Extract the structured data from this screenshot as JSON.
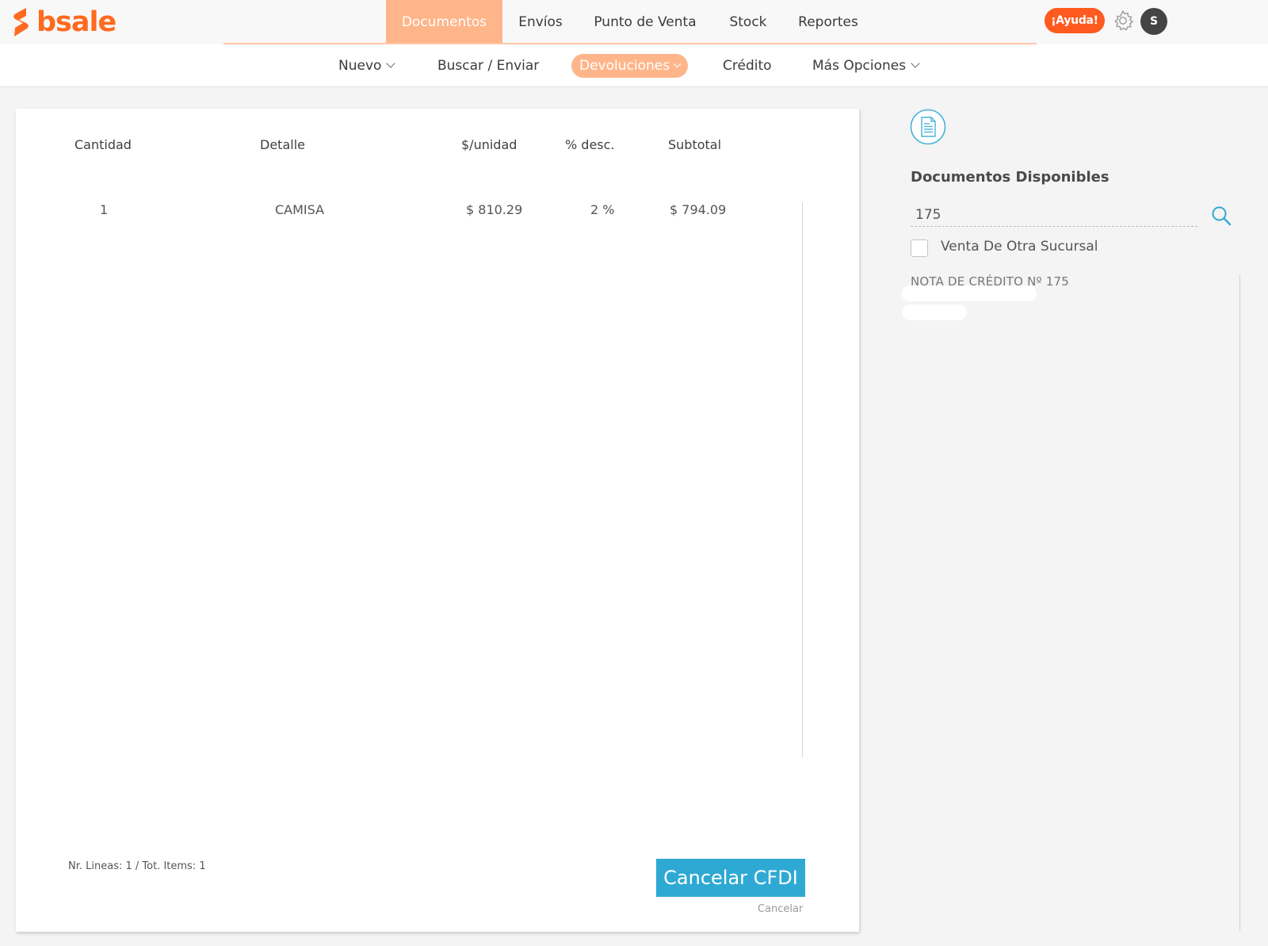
{
  "brand": {
    "logo_text": "bsale",
    "accent": "#ff6a1f"
  },
  "main_nav": {
    "items": [
      {
        "label": "Documentos",
        "active": true
      },
      {
        "label": "Envíos",
        "active": false
      },
      {
        "label": "Punto de Venta",
        "active": false
      },
      {
        "label": "Stock",
        "active": false
      },
      {
        "label": "Reportes",
        "active": false
      }
    ],
    "help_label": "¡Ayuda!",
    "avatar_initial": "S"
  },
  "sub_nav": {
    "items": [
      {
        "label": "Nuevo",
        "has_dropdown": true
      },
      {
        "label": "Buscar / Enviar",
        "has_dropdown": false
      },
      {
        "label": "Devoluciones",
        "has_dropdown": true,
        "active": true
      },
      {
        "label": "Crédito",
        "has_dropdown": false
      },
      {
        "label": "Más Opciones",
        "has_dropdown": true
      }
    ]
  },
  "document": {
    "columns": [
      "Cantidad",
      "Detalle",
      "$/unidad",
      "% desc.",
      "Subtotal"
    ],
    "rows": [
      {
        "cantidad": "1",
        "detalle": "CAMISA",
        "unit_price": "$ 810.29",
        "discount": "2 %",
        "subtotal": "$ 794.09"
      }
    ],
    "footer_count": "Nr. Lineas: 1 / Tot. Items: 1",
    "primary_button": "Cancelar CFDI",
    "cancel_link": "Cancelar"
  },
  "side_panel": {
    "icon": "document-icon",
    "title": "Documentos Disponibles",
    "search_value": "175",
    "checkbox_label": "Venta De Otra Sucursal",
    "checkbox_checked": false,
    "result_label": "NOTA DE CRÉDITO Nº 175"
  },
  "colors": {
    "nav_active": "#ffb58a",
    "help_button": "#ff5a1f",
    "primary_button": "#2ea9d4"
  }
}
